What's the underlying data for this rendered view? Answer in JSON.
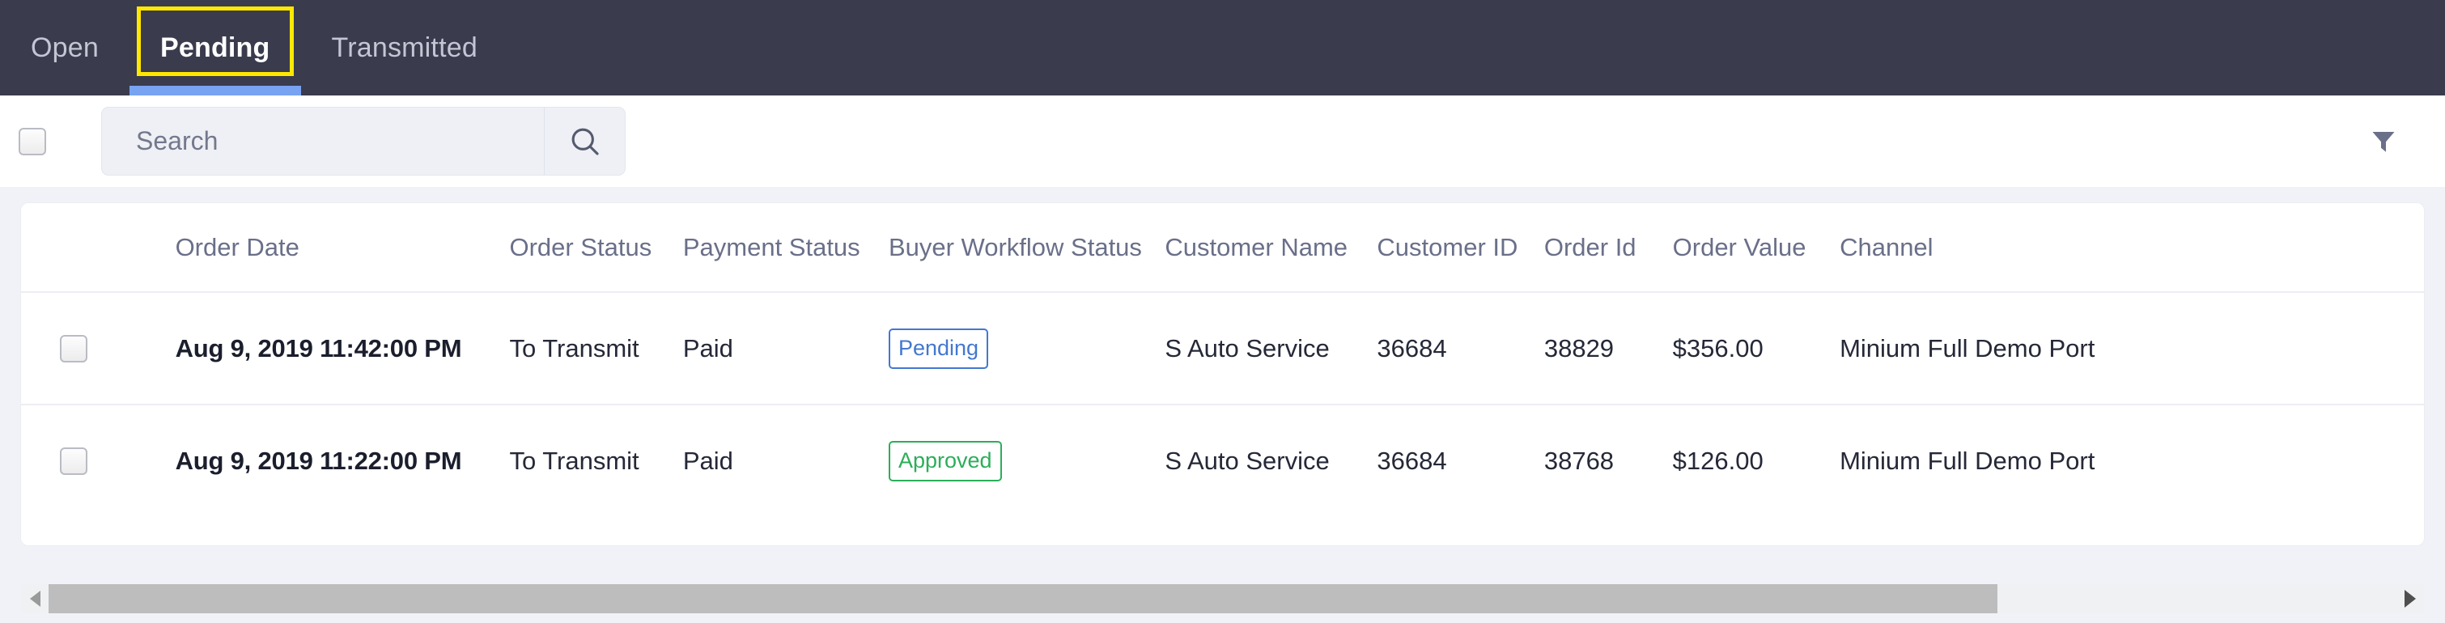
{
  "tabs": [
    {
      "label": "Open",
      "active": false
    },
    {
      "label": "Pending",
      "active": true,
      "focused": true
    },
    {
      "label": "Transmitted",
      "active": false
    }
  ],
  "toolbar": {
    "select_all_checkbox": "",
    "search": {
      "placeholder": "Search",
      "value": "",
      "button_icon": "search-icon"
    },
    "filter_icon": "filter-funnel-icon"
  },
  "table": {
    "columns": [
      "Order Date",
      "Order Status",
      "Payment Status",
      "Buyer Workflow Status",
      "Customer Name",
      "Customer ID",
      "Order Id",
      "Order Value",
      "Channel"
    ],
    "rows": [
      {
        "order_date": "Aug 9, 2019 11:42:00 PM",
        "order_status": "To Transmit",
        "payment_status": "Paid",
        "buyer_workflow_status": "Pending",
        "buyer_workflow_state": "pending",
        "customer_name": "S Auto Service",
        "customer_id": "36684",
        "order_id": "38829",
        "order_value": "$356.00",
        "channel": "Minium Full Demo Port"
      },
      {
        "order_date": "Aug 9, 2019 11:22:00 PM",
        "order_status": "To Transmit",
        "payment_status": "Paid",
        "buyer_workflow_status": "Approved",
        "buyer_workflow_state": "approved",
        "customer_name": "S Auto Service",
        "customer_id": "36684",
        "order_id": "38768",
        "order_value": "$126.00",
        "channel": "Minium Full Demo Port"
      }
    ]
  },
  "scrollbar": {
    "left_arrow_icon": "chevron-left-icon",
    "right_arrow_icon": "chevron-right-icon",
    "thumb_percent": 83
  },
  "colors": {
    "tabbar_bg": "#3a3b4d",
    "tab_active_underline": "#77a3f2",
    "focus_ring": "#ffe800",
    "page_bg": "#f0f2f7",
    "badge_pending": "#4278cf",
    "badge_approved": "#2cae5a"
  }
}
